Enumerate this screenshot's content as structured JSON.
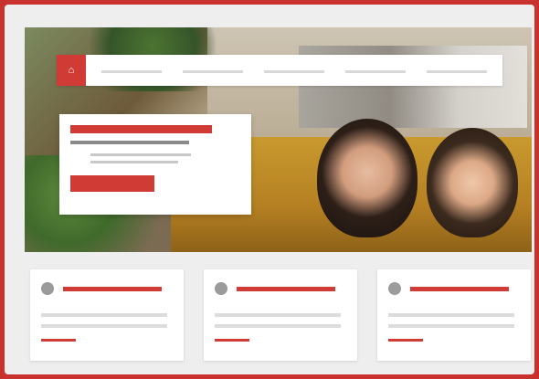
{
  "brand": {
    "logo_glyph": "⌂",
    "accent": "#d13b36"
  },
  "nav": {
    "items": [
      "",
      "",
      "",
      "",
      ""
    ]
  },
  "promo": {
    "title": "",
    "subtitle": "",
    "bullets": [
      "",
      ""
    ],
    "button_label": ""
  },
  "cards": [
    {
      "icon": "circle-icon",
      "title": "",
      "lines": [
        "",
        ""
      ],
      "link": ""
    },
    {
      "icon": "circle-icon",
      "title": "",
      "lines": [
        "",
        ""
      ],
      "link": ""
    },
    {
      "icon": "circle-icon",
      "title": "",
      "lines": [
        "",
        ""
      ],
      "link": ""
    }
  ]
}
